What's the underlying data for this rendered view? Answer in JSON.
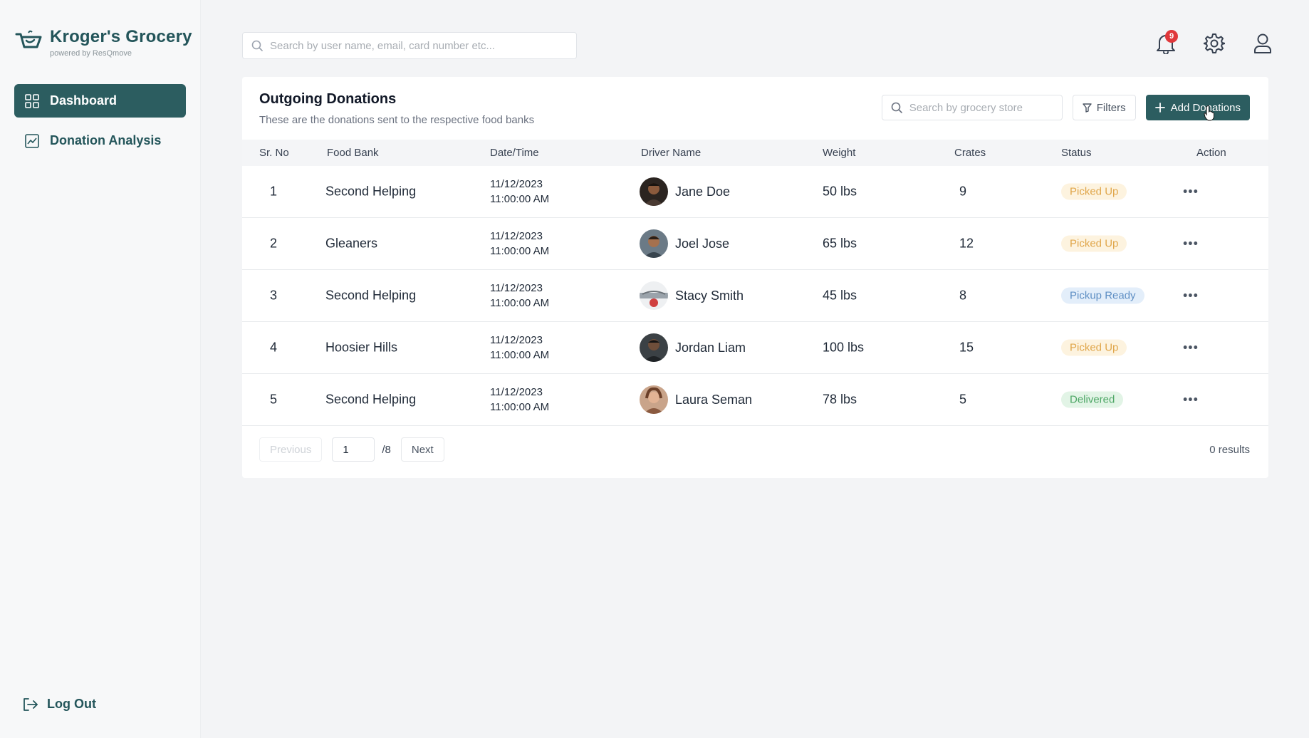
{
  "brand": {
    "name": "Kroger's Grocery",
    "subtitle": "powered by ResQmove"
  },
  "sidebar": {
    "items": [
      {
        "label": "Dashboard",
        "icon": "grid-icon",
        "active": true
      },
      {
        "label": "Donation Analysis",
        "icon": "chart-icon",
        "active": false
      }
    ],
    "logout_label": "Log Out"
  },
  "header": {
    "search_placeholder": "Search by user name, email, card number etc...",
    "notification_count": "9"
  },
  "donations": {
    "title": "Outgoing Donations",
    "description": "These are the donations sent to the respective food banks",
    "store_search_placeholder": "Search by grocery store",
    "filters_label": "Filters",
    "add_label": "Add Donations",
    "columns": [
      "Sr. No",
      "Food Bank",
      "Date/Time",
      "Driver Name",
      "Weight",
      "Crates",
      "Status",
      "Action"
    ],
    "rows": [
      {
        "sr": "1",
        "food_bank": "Second Helping",
        "date": "11/12/2023",
        "time": "11:00:00 AM",
        "driver": "Jane Doe",
        "weight": "50 lbs",
        "crates": "9",
        "status": "Picked Up",
        "action": "•••"
      },
      {
        "sr": "2",
        "food_bank": "Gleaners",
        "date": "11/12/2023",
        "time": "11:00:00 AM",
        "driver": "Joel Jose",
        "weight": "65 lbs",
        "crates": "12",
        "status": "Picked Up",
        "action": "•••"
      },
      {
        "sr": "3",
        "food_bank": "Second Helping",
        "date": "11/12/2023",
        "time": "11:00:00 AM",
        "driver": "Stacy Smith",
        "weight": "45 lbs",
        "crates": "8",
        "status": "Pickup Ready",
        "action": "•••"
      },
      {
        "sr": "4",
        "food_bank": "Hoosier Hills",
        "date": "11/12/2023",
        "time": "11:00:00 AM",
        "driver": "Jordan Liam",
        "weight": "100 lbs",
        "crates": "15",
        "status": "Picked Up",
        "action": "•••"
      },
      {
        "sr": "5",
        "food_bank": "Second Helping",
        "date": "11/12/2023",
        "time": "11:00:00 AM",
        "driver": "Laura Seman",
        "weight": "78 lbs",
        "crates": "5",
        "status": "Delivered",
        "action": "•••"
      }
    ],
    "pagination": {
      "previous_label": "Previous",
      "page": "1",
      "total": "/8",
      "next_label": "Next",
      "results": "0 results"
    }
  },
  "colors": {
    "brand": "#2c5d60",
    "status_picked_up_bg": "#fdf3df",
    "status_picked_up_fg": "#e0a64a",
    "status_pickup_ready_bg": "#e3eefa",
    "status_pickup_ready_fg": "#5f8fc4",
    "status_delivered_bg": "#e2f4e6",
    "status_delivered_fg": "#4ea766"
  }
}
